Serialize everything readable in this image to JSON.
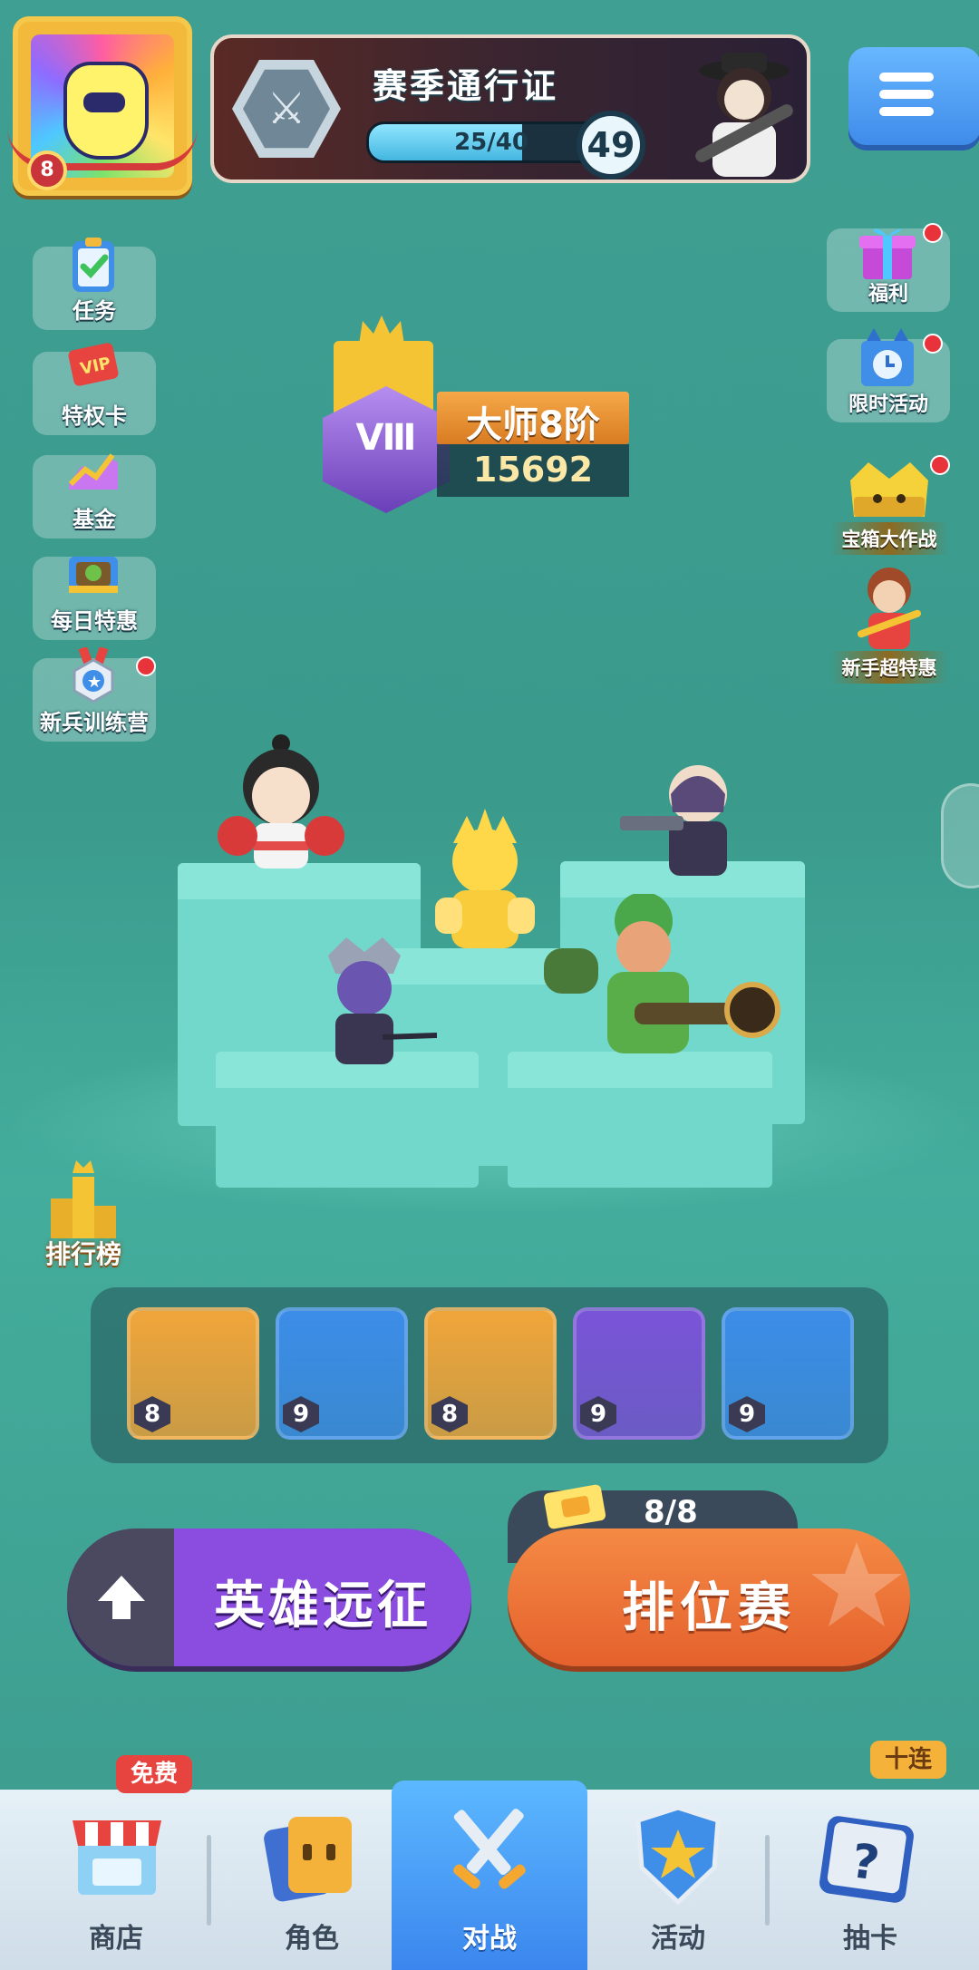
{
  "avatar": {
    "level": "8"
  },
  "season_pass": {
    "title": "赛季通行证",
    "progress": "25/40",
    "progress_fraction": 0.625,
    "level": "49"
  },
  "left_menu": [
    {
      "label": "任务",
      "icon": "clipboard-check-icon"
    },
    {
      "label": "特权卡",
      "icon": "vip-card-icon"
    },
    {
      "label": "基金",
      "icon": "gem-chart-icon"
    },
    {
      "label": "每日特惠",
      "icon": "treasure-chest-icon"
    },
    {
      "label": "新兵训练营",
      "icon": "medal-badge-icon"
    }
  ],
  "right_menu": [
    {
      "label": "福利",
      "icon": "gift-box-icon"
    },
    {
      "label": "限时活动",
      "icon": "clock-box-icon"
    },
    {
      "label": "宝箱大作战",
      "icon": "golden-chest-icon"
    },
    {
      "label": "新手超特惠",
      "icon": "hero-offer-icon"
    }
  ],
  "rank": {
    "emblem": "Ⅷ",
    "name": "大师8阶",
    "score": "15692"
  },
  "leaderboard": {
    "label": "排行榜"
  },
  "heroes": [
    {
      "level": "8",
      "color": "#f0a53a"
    },
    {
      "level": "9",
      "color": "#3c8de8"
    },
    {
      "level": "8",
      "color": "#f0a53a"
    },
    {
      "level": "9",
      "color": "#7a54d8"
    },
    {
      "level": "9",
      "color": "#3c8de8"
    }
  ],
  "actions": {
    "expedition_label": "英雄远征",
    "ticket_count": "8/8",
    "ranked_label": "排位赛"
  },
  "bottom_nav": [
    {
      "label": "商店",
      "badge": "免费"
    },
    {
      "label": "角色",
      "badge": ""
    },
    {
      "label": "对战",
      "badge": ""
    },
    {
      "label": "活动",
      "badge": ""
    },
    {
      "label": "抽卡",
      "badge": "十连"
    }
  ],
  "colors": {
    "accent_blue": "#3b86ee",
    "ranked_orange": "#e5612d",
    "expedition_purple": "#8a4de0",
    "alert_red": "#e8333a"
  }
}
